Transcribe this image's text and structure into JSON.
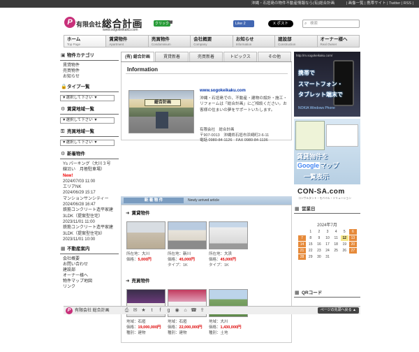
{
  "topbar": {
    "tagline": "沖縄・石垣島の物件不動産情報なら(有)総合計画",
    "links": "| 画像一覧 | 携帯サイト | Twitter | RSS |"
  },
  "header": {
    "logo_mark": "P",
    "company_type": "有限会社",
    "company_name": "総合計画",
    "url": "www.sogokeikaku.com",
    "click_tag": "クリック",
    "fb_like": "Like 2",
    "fb_count": "2",
    "x_post": "X ポスト",
    "search_placeholder": "検索"
  },
  "nav": [
    {
      "jp": "ホーム",
      "en": "Top Page"
    },
    {
      "jp": "賃貸物件",
      "en": "Apartment"
    },
    {
      "jp": "売買物件",
      "en": "Condominium"
    },
    {
      "jp": "会社概要",
      "en": "Company"
    },
    {
      "jp": "お知らせ",
      "en": "Information"
    },
    {
      "jp": "建設部",
      "en": "Construction"
    },
    {
      "jp": "オーナー様へ",
      "en": "Real Owner"
    }
  ],
  "sidebar": {
    "category_title": "物件カテゴリ",
    "categories": [
      "賃貸物件",
      "売買物件",
      "お知らせ"
    ],
    "type_title": "タイプ一覧",
    "select_placeholder": "▼選択して下さい ▼",
    "rent_area_title": "賃貸地域一覧",
    "sale_area_title": "売買地域一覧",
    "new_title": "新着物件",
    "new_items": [
      "Ys パーキング（大川３号",
      "線沿い　月極駐車場）",
      "New!",
      "2024/07/03 11:00",
      "エリアNK",
      "2024/06/29 15:17",
      "マンションサンシティー",
      "2024/06/28 16:47",
      "鉄筋コンクリート造平家建",
      "3LDK（提案型住宅）",
      "2023/11/01 11:00",
      "鉄筋コンクリート造平家建",
      "3LDK（提案型住宅Ⅱ）",
      "2023/11/01 10:00"
    ],
    "estate_title": "不動産案内",
    "estate_links": [
      "会社概要",
      "お問い合わせ",
      "建設部",
      "オーナー様へ",
      "物件マップ地図",
      "リンク"
    ]
  },
  "tabs": [
    "(有) 総合計画",
    "賃貸新着",
    "売買新着",
    "トピックス",
    "その他"
  ],
  "info": {
    "heading": "Information",
    "photo_sign": "総合計画",
    "url": "www.sogokeikaku.com",
    "description": "沖縄・石垣島での、不動産・建物の設計・施工・リフォームは「総合計画」にご相談ください。お客様の住まいの夢をサポートいたします。",
    "company": "有限会社　総合計画",
    "address": "〒907-0013　沖縄県石垣市浜崎町2-6-11",
    "phone": "電話 0980-84-1126　FAX 0980-84-1136"
  },
  "new_band": {
    "jp": "新 着 物 件",
    "en": "Newly arrived article"
  },
  "rentals": {
    "title": "賃貸物件",
    "items": [
      {
        "area_label": "所在地：",
        "area": "大川",
        "price_label": "価格：",
        "price": "5,000円"
      },
      {
        "area_label": "所在地：",
        "area": "新川",
        "price_label": "価格：",
        "price": "45,000円",
        "type": "タイプ：1K"
      },
      {
        "area_label": "所在地：",
        "area": "大浜",
        "price_label": "価格：",
        "price": "45,000円",
        "type": "タイプ：1K"
      }
    ]
  },
  "sales": {
    "title": "売買物件",
    "items": [
      {
        "area_label": "地域：",
        "area": "石垣",
        "price_label": "価格：",
        "price": "19,000,000円",
        "kind": "種別：建物"
      },
      {
        "area_label": "地域：",
        "area": "石垣",
        "price_label": "価格：",
        "price": "22,000,000円",
        "kind": "種別：建物"
      },
      {
        "area_label": "地域：",
        "area": "大川",
        "price_label": "価格：",
        "price": "1,430,000円",
        "kind": "種別：土地"
      }
    ]
  },
  "ads": {
    "ad1_url": "http://m.sogokeikaku.com/",
    "ad1_line1": "携帯で",
    "ad1_line2": "スマートフォン・",
    "ad1_line3": "タブレット端末で",
    "ad1_brand": "NOKIA  Windows Phone",
    "ad2_line1": "賃貸物件を",
    "ad2_line2_google": "Google",
    "ad2_line2_rest": "マップ",
    "ad2_line3": "一覧表示",
    "ad3_name": "CON-SA.com",
    "ad3_sub": "コンサルタント・モバイル・ソリューション"
  },
  "calendar": {
    "title": "営業日",
    "month": "2024年7月",
    "weeks": [
      [
        "",
        "1",
        "2",
        "3",
        "4",
        "5",
        "6"
      ],
      [
        "7",
        "8",
        "9",
        "10",
        "11",
        "12",
        "13"
      ],
      [
        "14",
        "15",
        "16",
        "17",
        "18",
        "19",
        "20"
      ],
      [
        "21",
        "22",
        "23",
        "24",
        "25",
        "26",
        "27"
      ],
      [
        "28",
        "29",
        "30",
        "31",
        "",
        "",
        ""
      ]
    ]
  },
  "qr_title": "QRコード",
  "bottom": {
    "logo_mark": "P",
    "name": "有限会社 総合計画",
    "top_button": "ページの先頭へ戻る ▲"
  },
  "colors": {
    "brand": "#c8307a",
    "nav_bg": "#e6e6e6",
    "price": "#dd0000",
    "calendar_off": "#e68a3a",
    "calendar_today": "#f5e78a"
  }
}
